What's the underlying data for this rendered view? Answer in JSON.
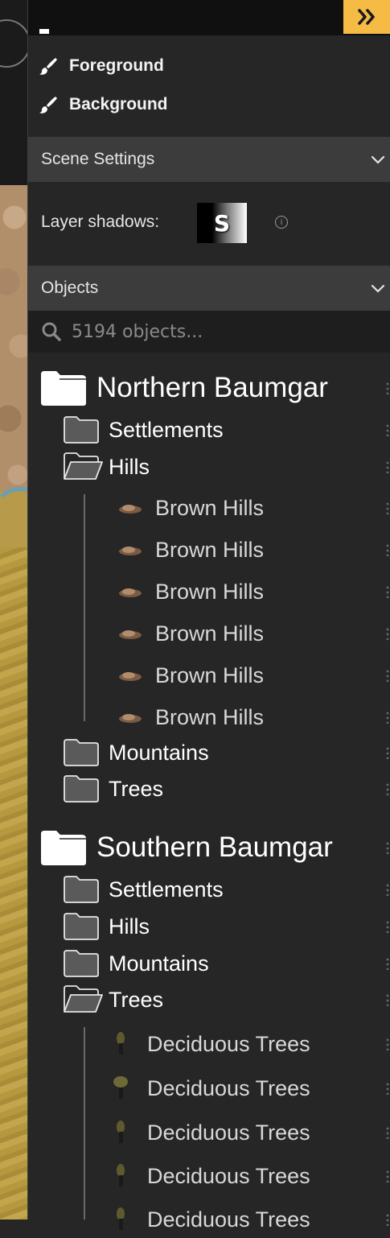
{
  "toolbar": {
    "collapse_icon": "double-chevron-right-icon",
    "accent": "#f5bb45"
  },
  "layers": [
    {
      "label": "Foreground",
      "icon": "brush-icon"
    },
    {
      "label": "Background",
      "icon": "brush-icon"
    }
  ],
  "scene_settings": {
    "title": "Scene Settings",
    "layer_shadows_label": "Layer shadows:",
    "shadow_preview_letter": "S",
    "info_icon": "i"
  },
  "objects": {
    "title": "Objects",
    "search_placeholder": "5194 objects...",
    "groups": [
      {
        "label": "Northern Baumgar",
        "children": [
          {
            "label": "Settlements",
            "open": false
          },
          {
            "label": "Hills",
            "open": true,
            "items": [
              "Brown Hills",
              "Brown Hills",
              "Brown Hills",
              "Brown Hills",
              "Brown Hills",
              "Brown Hills"
            ]
          },
          {
            "label": "Mountains",
            "open": false
          },
          {
            "label": "Trees",
            "open": false
          }
        ]
      },
      {
        "label": "Southern Baumgar",
        "children": [
          {
            "label": "Settlements",
            "open": false
          },
          {
            "label": "Hills",
            "open": false
          },
          {
            "label": "Mountains",
            "open": false
          },
          {
            "label": "Trees",
            "open": true,
            "items": [
              "Deciduous Trees",
              "Deciduous Trees",
              "Deciduous Trees",
              "Deciduous Trees",
              "Deciduous Trees"
            ]
          }
        ]
      }
    ]
  }
}
